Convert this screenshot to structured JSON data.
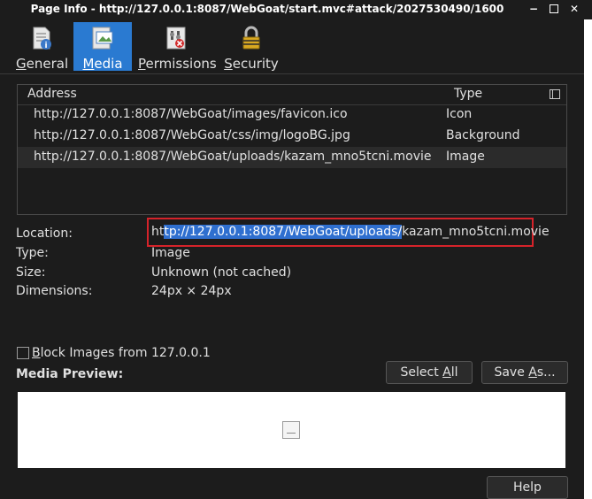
{
  "window": {
    "title": "Page Info - http://127.0.0.1:8087/WebGoat/start.mvc#attack/2027530490/1600",
    "min_glyph": "−",
    "close_glyph": "✕"
  },
  "tabs": [
    {
      "label_pre": "",
      "mnemonic": "G",
      "label_post": "eneral",
      "icon": "general-icon",
      "active": false
    },
    {
      "label_pre": "",
      "mnemonic": "M",
      "label_post": "edia",
      "icon": "media-icon",
      "active": true
    },
    {
      "label_pre": "",
      "mnemonic": "P",
      "label_post": "ermissions",
      "icon": "permissions-icon",
      "active": false
    },
    {
      "label_pre": "",
      "mnemonic": "S",
      "label_post": "ecurity",
      "icon": "security-lock-icon",
      "active": false
    }
  ],
  "media_list": {
    "headers": {
      "address": "Address",
      "type": "Type"
    },
    "rows": [
      {
        "address": "http://127.0.0.1:8087/WebGoat/images/favicon.ico",
        "type": "Icon"
      },
      {
        "address": "http://127.0.0.1:8087/WebGoat/css/img/logoBG.jpg",
        "type": "Background"
      },
      {
        "address": "http://127.0.0.1:8087/WebGoat/uploads/kazam_mno5tcni.movie",
        "type": "Image",
        "selected": true
      }
    ]
  },
  "details": {
    "location_label": "Location:",
    "location_pre": "ht",
    "location_selected": "tp://127.0.0.1:8087/WebGoat/uploads/",
    "location_post": "kazam_mno5tcni.movie",
    "type_label": "Type:",
    "type_value": "Image",
    "size_label": "Size:",
    "size_value": "Unknown (not cached)",
    "dimensions_label": "Dimensions:",
    "dimensions_value": "24px × 24px"
  },
  "block_images": {
    "pre": "",
    "mnemonic": "B",
    "post": "lock Images from 127.0.0.1",
    "checked": false
  },
  "buttons": {
    "select_all_pre": "Select ",
    "select_all_mn": "A",
    "select_all_post": "ll",
    "save_as_pre": "Save ",
    "save_as_mn": "A",
    "save_as_post": "s...",
    "help": "Help"
  },
  "preview": {
    "label": "Media Preview:"
  },
  "colors": {
    "accent": "#2a7ad1",
    "highlight_box": "#d6232a",
    "selection": "#2f6fcf"
  }
}
